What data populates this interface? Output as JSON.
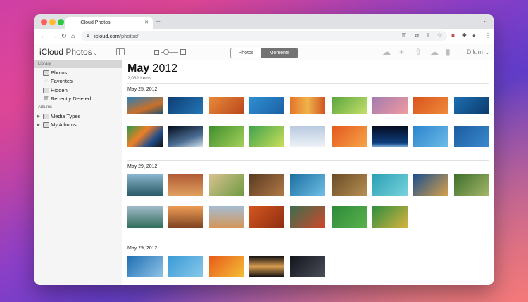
{
  "browser": {
    "tab_title": "iCloud Photos",
    "url_host": "icloud.com",
    "url_path": "/photos/",
    "traffic_lights": [
      "#ff5f57",
      "#febc2e",
      "#28c840"
    ]
  },
  "app": {
    "brand_bold": "iCloud",
    "brand_rest": "Photos",
    "segments": [
      "Photos",
      "Moments"
    ],
    "active_segment": "Moments",
    "user": "Dilum"
  },
  "sidebar": {
    "library_header": "Library",
    "library_items": [
      {
        "label": "Photos",
        "icon": "photo-icon"
      },
      {
        "label": "Favorites",
        "icon": "heart-icon"
      },
      {
        "label": "Hidden",
        "icon": "hidden-icon"
      },
      {
        "label": "Recently Deleted",
        "icon": "trash-icon"
      }
    ],
    "albums_header": "Albums",
    "album_items": [
      {
        "label": "Media Types",
        "icon": "folder-icon"
      },
      {
        "label": "My Albums",
        "icon": "folder-icon"
      }
    ]
  },
  "main": {
    "title_month": "May",
    "title_year": "2012",
    "count": "2,032 Items",
    "sections": [
      {
        "date": "May 25, 2012",
        "rows": [
          [
            "linear-gradient(160deg,#2a7fb8,#c9702a 60%,#1e4f6e)",
            "linear-gradient(135deg,#0e3d74,#2478b8)",
            "linear-gradient(135deg,#e98a3a,#b9461c)",
            "linear-gradient(135deg,#2f8fd3,#1b5fa2)",
            "linear-gradient(90deg,#e4742a,#f1b34a,#d05320)",
            "linear-gradient(135deg,#5aa43d,#c4e06a)",
            "linear-gradient(135deg,#a37bb0,#f19aa0)",
            "linear-gradient(135deg,#d9541e,#f08a3a)",
            "linear-gradient(135deg,#1c6fb3,#0c3a6a)"
          ],
          [
            "linear-gradient(135deg,#2a9b4a,#f07e26 40%,#234e8a 70%,#111)",
            "linear-gradient(160deg,#030a1a,#4b6d92 60%,#d9e6f1)",
            "linear-gradient(135deg,#3f8e2c,#a5d15a)",
            "linear-gradient(135deg,#3fa24c,#cde05a)",
            "linear-gradient(180deg,#b8c9df,#eef3f8)",
            "linear-gradient(135deg,#e4571f,#f7a646)",
            "linear-gradient(180deg,#050a1c,#0d3f7e 80%,#87bde6)",
            "linear-gradient(135deg,#2b84cd,#6dbde8)",
            "linear-gradient(135deg,#1c5c9e,#3b8ad0)"
          ]
        ]
      },
      {
        "date": "May 29, 2012",
        "rows": [
          [
            "linear-gradient(180deg,#8cb5d0,#4d7d8c 60%,#2a5b6b)",
            "linear-gradient(180deg,#b15a35,#e0a15f)",
            "linear-gradient(135deg,#d8c290,#6e9a40)",
            "linear-gradient(135deg,#5a3a22,#b17a46)",
            "linear-gradient(135deg,#1b6fa0,#6fc0e6)",
            "linear-gradient(135deg,#6a4b26,#b68f52)",
            "linear-gradient(135deg,#2aa0b5,#7ad3dc)",
            "linear-gradient(135deg,#1b4f8d,#d9a14a)",
            "linear-gradient(135deg,#3d6e2a,#a5b86a)"
          ],
          [
            "linear-gradient(180deg,#9fb9c8,#2f6b5a)",
            "linear-gradient(180deg,#ec9a55,#7c4220)",
            "linear-gradient(180deg,#a6bccf,#d59557)",
            "linear-gradient(135deg,#d4561e,#8c2d12)",
            "linear-gradient(135deg,#3d6e4f,#d0472a)",
            "linear-gradient(135deg,#2d8a3a,#5ab24c)",
            "linear-gradient(135deg,#2e8f3f,#d9b23f)"
          ]
        ]
      },
      {
        "date": "May 29, 2012",
        "rows": [
          [
            "linear-gradient(135deg,#1e6fb3,#8fc3e7)",
            "linear-gradient(135deg,#3a9ad6,#88c9ea)",
            "linear-gradient(135deg,#e85a1a,#f3c036)",
            "linear-gradient(180deg,#0b0b10,#d59a4e 50%,#0b0b10)",
            "linear-gradient(135deg,#12141c,#4a4e58)"
          ]
        ]
      }
    ]
  }
}
